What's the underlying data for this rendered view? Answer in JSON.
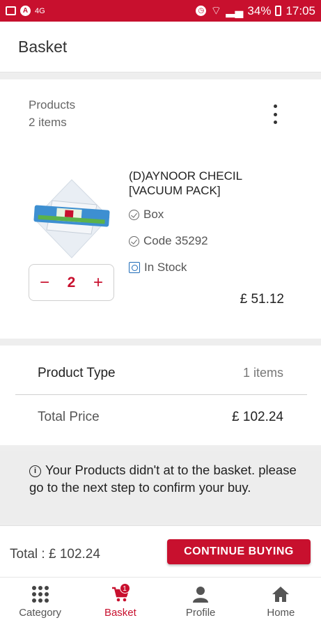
{
  "status_bar": {
    "battery": "34%",
    "time": "17:05",
    "network": "4G"
  },
  "app_bar": {
    "title": "Basket"
  },
  "products": {
    "label": "Products",
    "count": "2 items",
    "items": [
      {
        "name": "(D)AYNOOR CHECIL [VACUUM PACK]",
        "unit": "Box",
        "code": "Code 35292",
        "stock": "In Stock",
        "quantity": "2",
        "minus": "−",
        "plus": "+",
        "price": "£ 51.12"
      }
    ]
  },
  "summary": {
    "type_label": "Product Type",
    "type_value": "1 items",
    "total_label": "Total Price",
    "total_value": "£ 102.24"
  },
  "notice": {
    "icon": "info-icon",
    "text": "Your Products didn't at to the basket. please go to the next step to confirm your buy."
  },
  "checkout": {
    "total": "Total : £ 102.24",
    "continue_label": "CONTINUE BUYING"
  },
  "nav": {
    "items": [
      {
        "label": "Category",
        "icon": "grid-icon"
      },
      {
        "label": "Basket",
        "icon": "cart-icon",
        "badge": "1"
      },
      {
        "label": "Profile",
        "icon": "person-icon"
      },
      {
        "label": "Home",
        "icon": "home-icon"
      }
    ]
  },
  "colors": {
    "brand": "#c8102e",
    "stock": "#1e6bb8"
  }
}
